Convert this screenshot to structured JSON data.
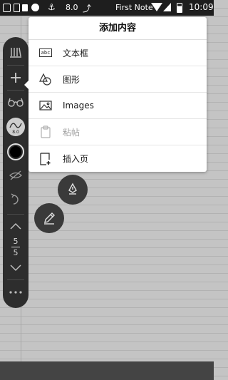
{
  "status_bar": {
    "version": "8.0",
    "app_title": "First Note",
    "time": "10:09",
    "more_glyph": "…",
    "anchor_glyph": "⚓",
    "cast_glyph": "⤴"
  },
  "toolbar": {
    "pen_size": "8.0",
    "current_page": "5",
    "total_pages": "5",
    "current_color": "#000000",
    "icons": [
      "notebooks-icon",
      "add-icon",
      "glasses-icon",
      "pen-settings-icon",
      "color-icon",
      "hide-icon",
      "undo-icon",
      "page-up-icon",
      "page-down-icon",
      "more-icon"
    ]
  },
  "menu": {
    "title": "添加内容",
    "items": [
      {
        "label": "文本框",
        "icon": "text-box-icon",
        "enabled": true,
        "icon_text": "abc"
      },
      {
        "label": "图形",
        "icon": "shapes-icon",
        "enabled": true
      },
      {
        "label": "Images",
        "icon": "image-icon",
        "enabled": true
      },
      {
        "label": "粘帖",
        "icon": "paste-icon",
        "enabled": false
      },
      {
        "label": "插入页",
        "icon": "insert-page-icon",
        "enabled": true
      }
    ]
  },
  "fabs": [
    "fountain-pen-icon",
    "pencil-icon"
  ],
  "colors": {
    "toolbar_bg": "#2d2d2d",
    "paper_bg": "#c4c4c4",
    "status_bar_bg": "#1e1e1e",
    "menu_bg": "#ffffff"
  }
}
